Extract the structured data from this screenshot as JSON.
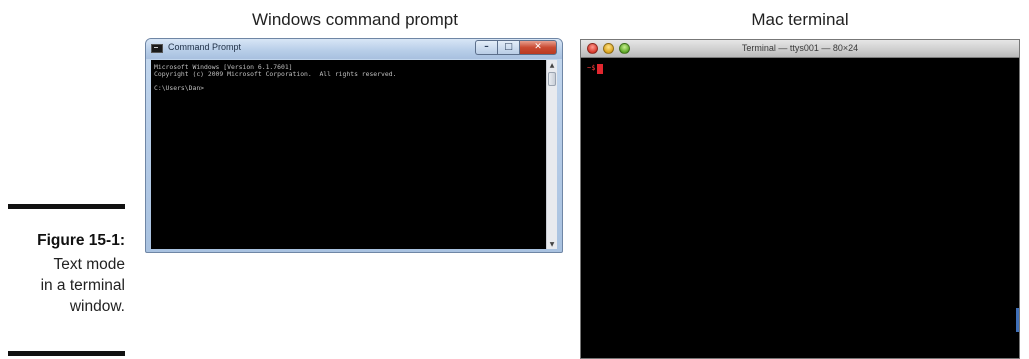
{
  "captions": {
    "windows": "Windows command prompt",
    "mac": "Mac terminal"
  },
  "figure": {
    "label": "Figure 15-1:",
    "text_lines": [
      "Text mode",
      "in a terminal",
      "window."
    ]
  },
  "windows_window": {
    "title": "Command Prompt",
    "controls": {
      "minimize": "–",
      "maximize": "□",
      "close": "✕"
    },
    "console_lines": [
      "Microsoft Windows [Version 6.1.7601]",
      "Copyright (c) 2009 Microsoft Corporation.  All rights reserved.",
      "C:\\Users\\Dan>"
    ],
    "scroll_up": "▲",
    "scroll_down": "▼",
    "colors": {
      "console_bg": "#000000",
      "console_text": "#c0c0c0",
      "close_button": "#c94a32"
    }
  },
  "mac_window": {
    "title": "Terminal — ttys001 — 80×24",
    "prompt": "~$",
    "colors": {
      "background": "#000000",
      "prompt_text": "#ff3b3b",
      "cursor": "#e2272f",
      "close_light": "#d7382a",
      "minimize_light": "#d9a21b",
      "zoom_light": "#5aa524"
    }
  }
}
